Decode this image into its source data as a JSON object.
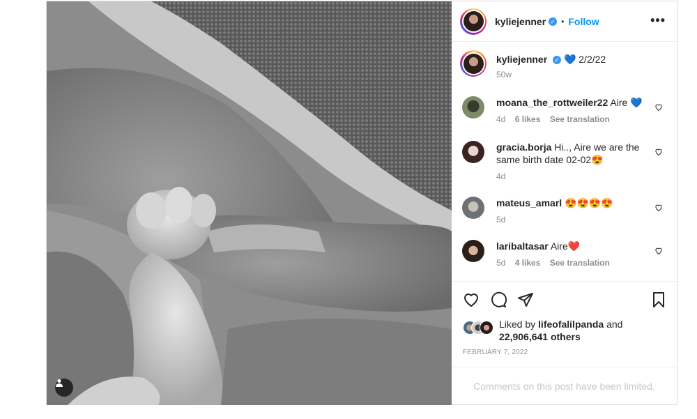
{
  "post": {
    "author": "kyliejenner",
    "follow_label": "Follow",
    "separator": "•",
    "more_icon": "more-horizontal-icon"
  },
  "caption": {
    "username": "kyliejenner",
    "emoji": "💙",
    "text": "2/2/22",
    "age": "50w"
  },
  "comments": [
    {
      "username": "moana_the_rottweiler22",
      "text": "Aire 💙",
      "age": "4d",
      "likes": "6 likes",
      "translate": "See translation",
      "avatar_color": "#6b7b59"
    },
    {
      "username": "gracia.borja",
      "text": "Hi.., Aire we are the same birth date 02-02😍",
      "age": "4d",
      "likes": "",
      "translate": "",
      "avatar_color": "#b5868a"
    },
    {
      "username": "mateus_amarl",
      "text": "😍😍😍😍",
      "age": "5d",
      "likes": "",
      "translate": "",
      "avatar_color": "#8a8f95"
    },
    {
      "username": "laribaltasar",
      "text": "Aire❤️",
      "age": "5d",
      "likes": "4 likes",
      "translate": "See translation",
      "avatar_color": "#3b2a24"
    }
  ],
  "likes": {
    "prefix": "Liked by",
    "user": "lifeofalilpanda",
    "and": "and",
    "count": "22,906,641 others"
  },
  "date": "FEBRUARY 7, 2022",
  "limited_text": "Comments on this post have been limited.",
  "colors": {
    "accent": "#0095f6",
    "verified": "#3897f0",
    "muted": "#8e8e8e"
  }
}
